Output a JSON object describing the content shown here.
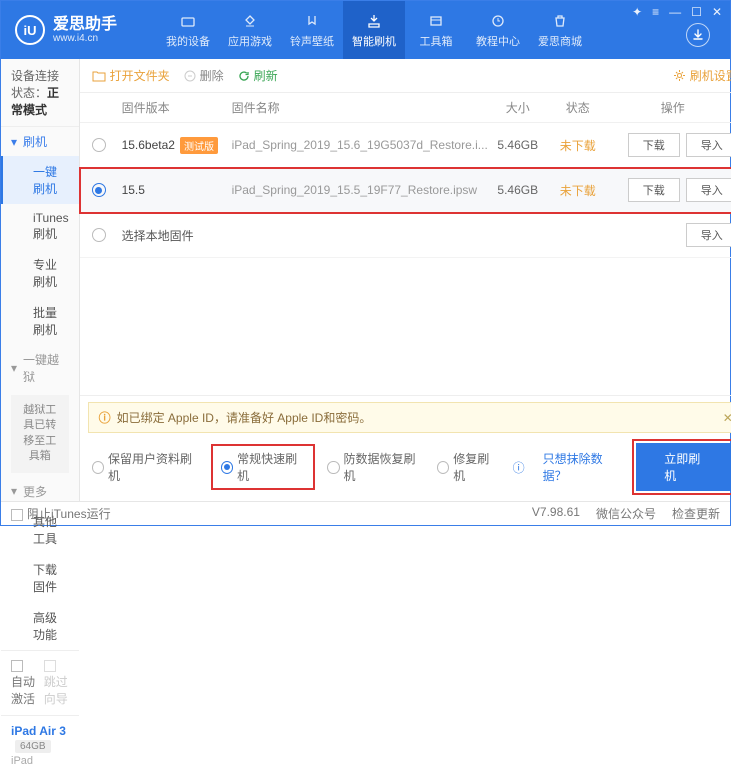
{
  "brand": {
    "name": "爱思助手",
    "url": "www.i4.cn",
    "logo_letter": "iU"
  },
  "win_controls": [
    "✦",
    "≡",
    "—",
    "☐",
    "✕"
  ],
  "nav": [
    {
      "label": "我的设备"
    },
    {
      "label": "应用游戏"
    },
    {
      "label": "铃声壁纸"
    },
    {
      "label": "智能刷机",
      "active": true
    },
    {
      "label": "工具箱"
    },
    {
      "label": "教程中心"
    },
    {
      "label": "爱思商城"
    }
  ],
  "sidebar": {
    "status_label": "设备连接状态：",
    "status_value": "正常模式",
    "groups": [
      {
        "head": "刷机",
        "icon": "flash",
        "color": "blue",
        "items": [
          {
            "label": "一键刷机",
            "active": true
          },
          {
            "label": "iTunes刷机"
          },
          {
            "label": "专业刷机"
          },
          {
            "label": "批量刷机"
          }
        ]
      },
      {
        "head": "一键越狱",
        "icon": "lock",
        "color": "gray",
        "note": "越狱工具已转移至工具箱"
      },
      {
        "head": "更多",
        "icon": "more",
        "color": "gray",
        "items": [
          {
            "label": "其他工具"
          },
          {
            "label": "下载固件"
          },
          {
            "label": "高级功能"
          }
        ]
      }
    ],
    "auto_activate": "自动激活",
    "skip_guide": "跳过向导",
    "device": {
      "name": "iPad Air 3",
      "capacity": "64GB",
      "type": "iPad"
    }
  },
  "toolbar": {
    "open": "打开文件夹",
    "delete": "删除",
    "refresh": "刷新",
    "settings": "刷机设置"
  },
  "table": {
    "headers": {
      "version": "固件版本",
      "name": "固件名称",
      "size": "大小",
      "status": "状态",
      "ops": "操作"
    },
    "rows": [
      {
        "selected": false,
        "version": "15.6beta2",
        "badge": "测试版",
        "name": "iPad_Spring_2019_15.6_19G5037d_Restore.i...",
        "size": "5.46GB",
        "status": "未下载"
      },
      {
        "selected": true,
        "version": "15.5",
        "name": "iPad_Spring_2019_15.5_19F77_Restore.ipsw",
        "size": "5.46GB",
        "status": "未下载"
      }
    ],
    "local_label": "选择本地固件",
    "btn_download": "下载",
    "btn_import": "导入"
  },
  "notice": {
    "text": "如已绑定 Apple ID，请准备好 Apple ID和密码。",
    "icon": "!"
  },
  "modes": {
    "keep": "保留用户资料刷机",
    "normal": "常规快速刷机",
    "antirec": "防数据恢复刷机",
    "repair": "修复刷机",
    "exclude": "只想抹除数据？",
    "go": "立即刷机"
  },
  "footer": {
    "block": "阻止iTunes运行",
    "version": "V7.98.61",
    "wechat": "微信公众号",
    "update": "检查更新"
  }
}
